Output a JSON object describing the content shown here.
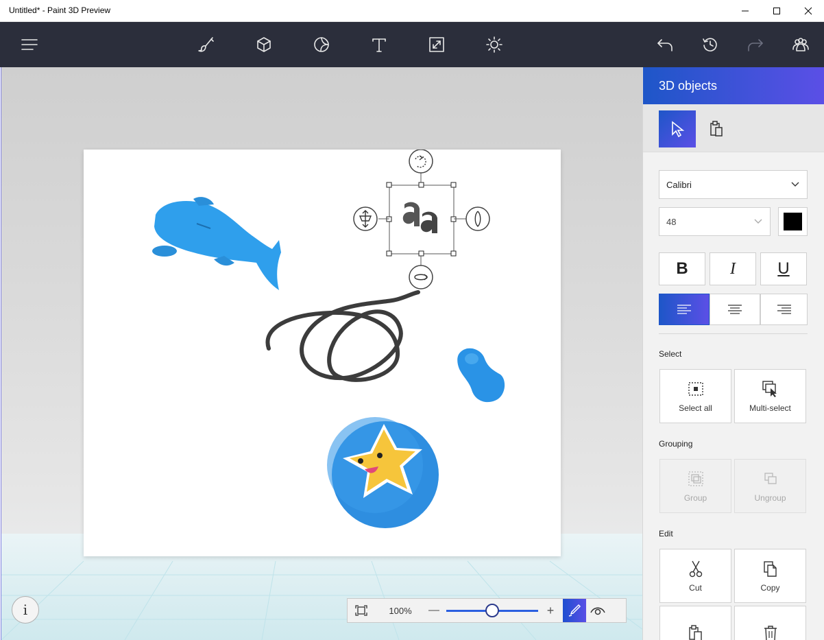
{
  "window": {
    "title": "Untitled* - Paint 3D Preview"
  },
  "toolbar": {
    "menu_icon": "hamburger-icon",
    "tools": [
      "brush-icon",
      "cube-icon",
      "sticker-icon",
      "text-icon",
      "canvas-resize-icon",
      "effects-icon"
    ],
    "actions": [
      "undo-icon",
      "history-icon",
      "redo-icon",
      "remix-people-icon"
    ]
  },
  "sidebar": {
    "header": "3D objects",
    "font": "Calibri",
    "size": "48",
    "text_color": "#000000",
    "format": {
      "bold": "B",
      "italic": "I",
      "underline": "U"
    },
    "sections": {
      "select": {
        "label": "Select",
        "select_all": "Select all",
        "multi_select": "Multi-select"
      },
      "grouping": {
        "label": "Grouping",
        "group": "Group",
        "ungroup": "Ungroup"
      },
      "edit": {
        "label": "Edit",
        "cut": "Cut",
        "copy": "Copy"
      }
    }
  },
  "zoom": {
    "value": "100%",
    "minus": "—",
    "plus": "+",
    "level_fraction": 0.5
  },
  "info": {
    "label": "i"
  },
  "colors": {
    "accent_start": "#1e56c8",
    "accent_end": "#5b4fe6",
    "toolbar": "#2b2e3b"
  }
}
